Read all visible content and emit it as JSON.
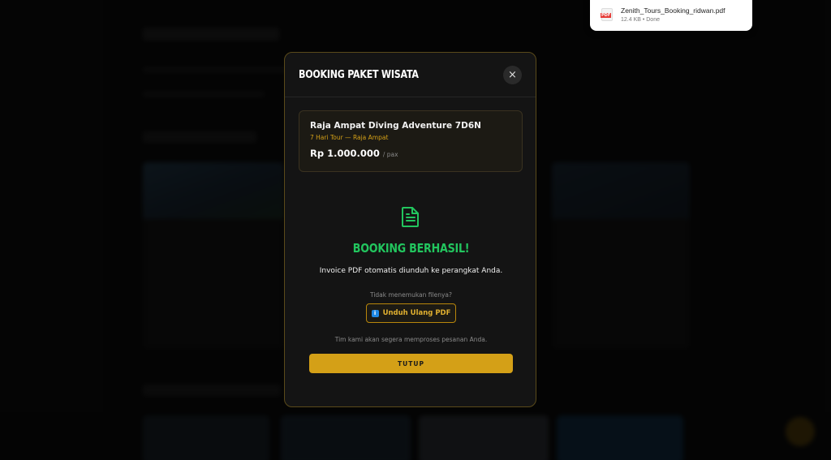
{
  "download": {
    "file_name": "Zenith_Tours_Booking_ridwan.pdf",
    "meta": "12.4 KB • Done"
  },
  "modal": {
    "title": "BOOKING PAKET WISATA",
    "close_glyph": "×",
    "package": {
      "name": "Raja Ampat Diving Adventure 7D6N",
      "subtitle": "7 Hari Tour — Raja Ampat",
      "price": "Rp 1.000.000",
      "unit": "/ pax"
    },
    "success_title": "BOOKING BERHASIL!",
    "invoice_text": "Invoice PDF otomatis diunduh ke perangkat Anda.",
    "hint_text": "Tidak menemukan filenya?",
    "redownload_label": "Unduh Ulang PDF",
    "info_glyph": "i",
    "team_text": "Tim kami akan segera memproses pesanan Anda.",
    "close_button_label": "TUTUP"
  },
  "colors": {
    "accent": "#d4a017",
    "success": "#22c55e",
    "modal_bg": "#141414"
  },
  "icons": {
    "document": "document-icon",
    "close": "close-icon",
    "pdf": "pdf-file-icon",
    "info": "info-icon"
  }
}
